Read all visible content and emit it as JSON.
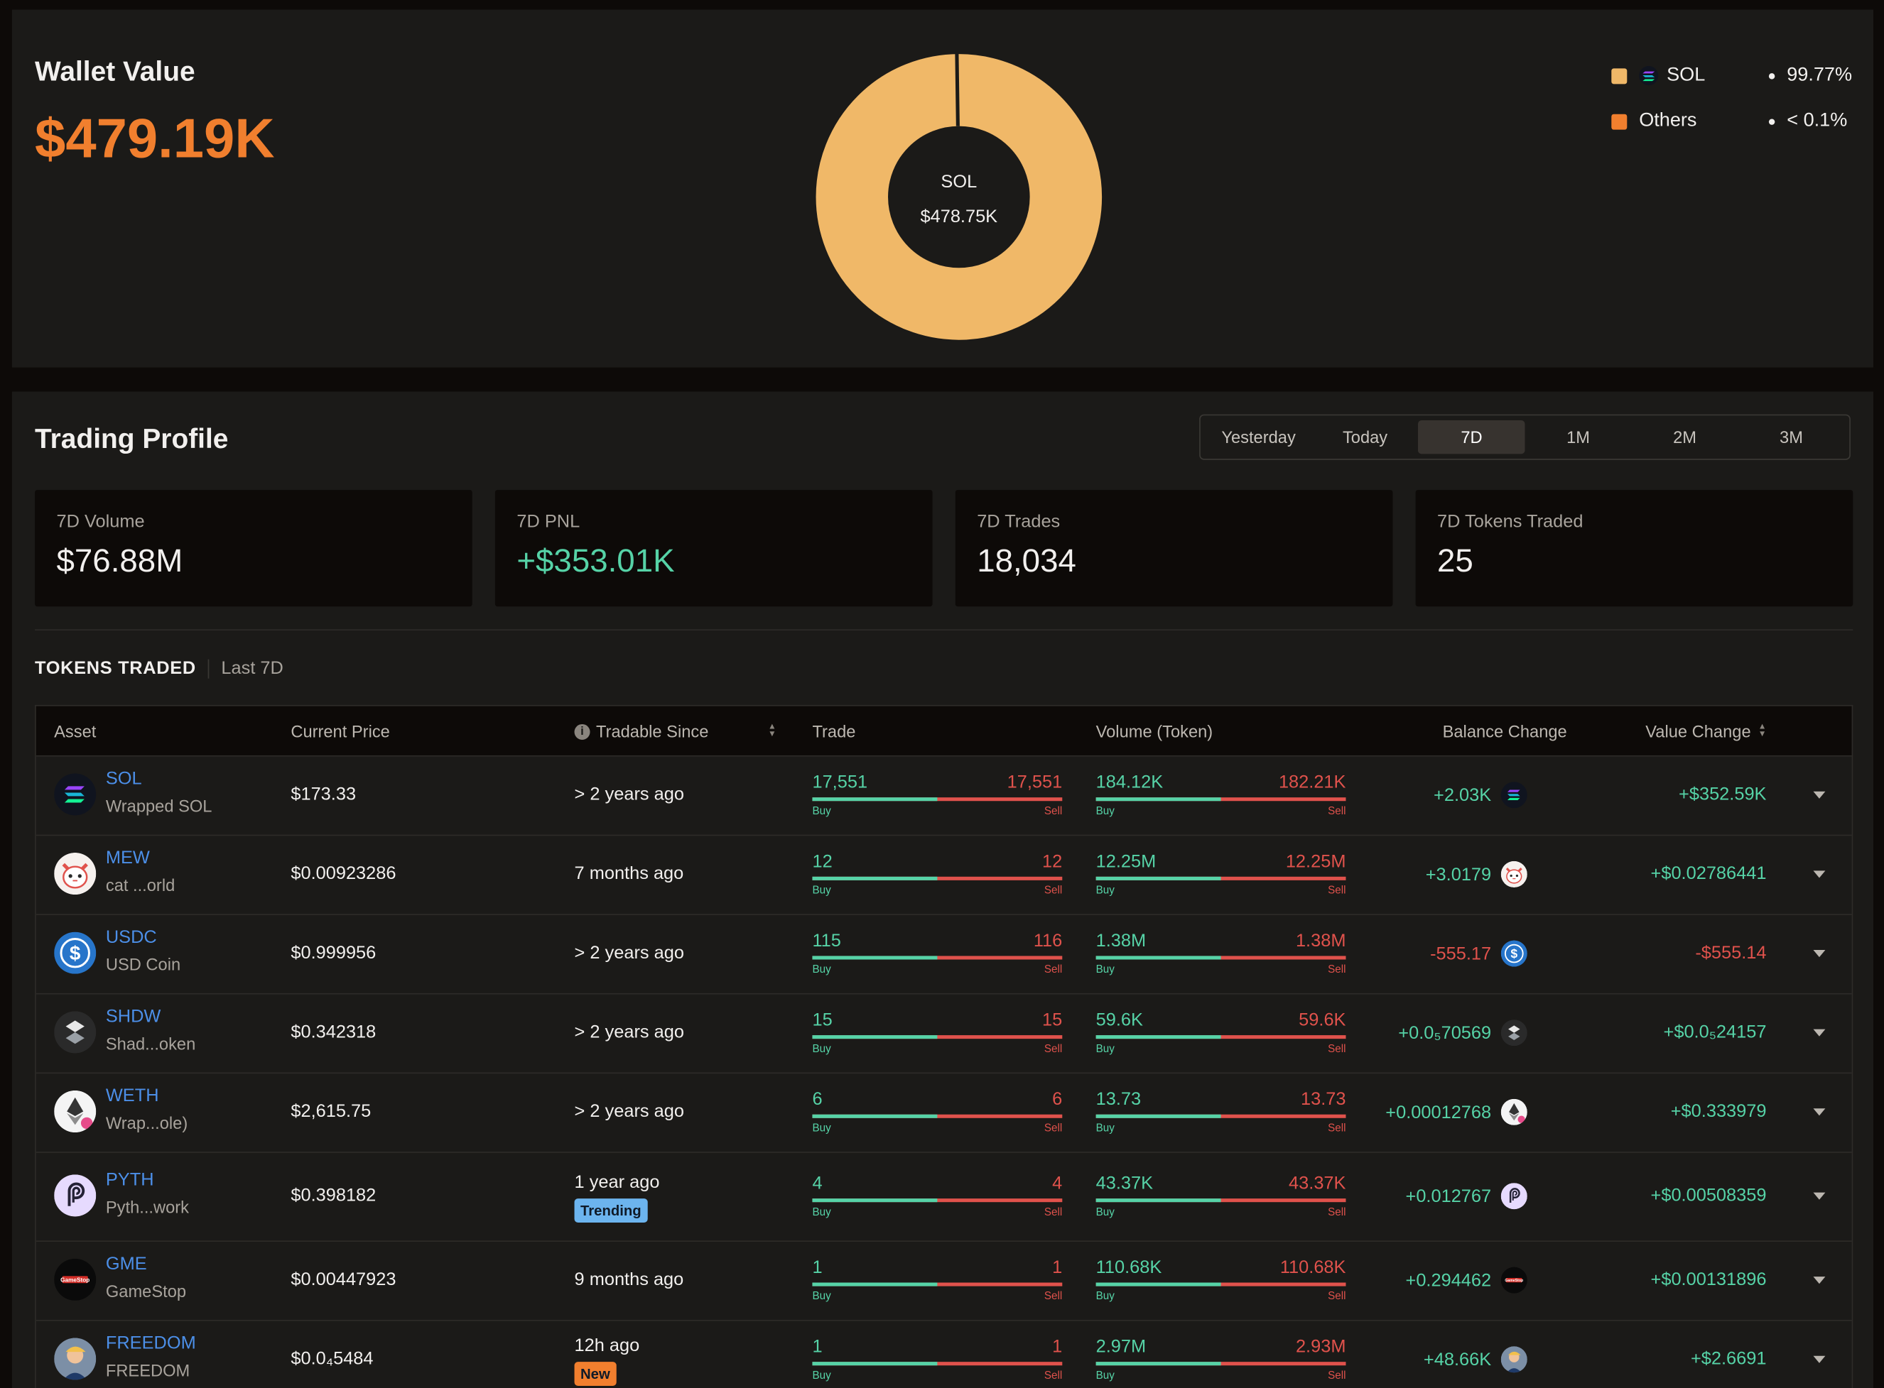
{
  "wallet": {
    "title": "Wallet Value",
    "value": "$479.19K",
    "donut_center_symbol": "SOL",
    "donut_center_value": "$478.75K",
    "donut_share_sol": 0.9977,
    "legend": [
      {
        "name": "SOL",
        "pct": "99.77%",
        "color": "#f0b868",
        "icon": "sol-icon"
      },
      {
        "name": "Others",
        "pct": "< 0.1%",
        "color": "#f17f2e",
        "icon": ""
      }
    ]
  },
  "trading_profile": {
    "title": "Trading Profile",
    "periods": [
      "Yesterday",
      "Today",
      "7D",
      "1M",
      "2M",
      "3M"
    ],
    "active_period": "7D",
    "stats": [
      {
        "label": "7D Volume",
        "value": "$76.88M",
        "color": "#f2f0ee"
      },
      {
        "label": "7D PNL",
        "value": "+$353.01K",
        "color": "#56d3a7"
      },
      {
        "label": "7D Trades",
        "value": "18,034",
        "color": "#f2f0ee"
      },
      {
        "label": "7D Tokens Traded",
        "value": "25",
        "color": "#f2f0ee"
      }
    ]
  },
  "tokens_traded": {
    "title": "TOKENS TRADED",
    "subtitle": "Last 7D",
    "columns": [
      "Asset",
      "Current Price",
      "Tradable Since",
      "Trade",
      "Volume (Token)",
      "Balance Change",
      "Value Change"
    ],
    "buy_label": "Buy",
    "sell_label": "Sell",
    "rows": [
      {
        "symbol": "SOL",
        "name": "Wrapped SOL",
        "price": "$173.33",
        "since": "> 2 years ago",
        "badge": "",
        "trade_buy": "17,551",
        "trade_sell": "17,551",
        "trade_buy_share": 0.5,
        "vol_buy": "184.12K",
        "vol_sell": "182.21K",
        "vol_buy_share": 0.5,
        "balance": "+2.03K",
        "balance_sign": "pos",
        "value": "+$352.59K",
        "value_sign": "pos",
        "icon": "sol-icon"
      },
      {
        "symbol": "MEW",
        "name": "cat ...orld",
        "price": "$0.00923286",
        "since": "7 months ago",
        "badge": "",
        "trade_buy": "12",
        "trade_sell": "12",
        "trade_buy_share": 0.5,
        "vol_buy": "12.25M",
        "vol_sell": "12.25M",
        "vol_buy_share": 0.5,
        "balance": "+3.0179",
        "balance_sign": "pos",
        "value": "+$0.02786441",
        "value_sign": "pos",
        "icon": "mew-cat-icon"
      },
      {
        "symbol": "USDC",
        "name": "USD Coin",
        "price": "$0.999956",
        "since": "> 2 years ago",
        "badge": "",
        "trade_buy": "115",
        "trade_sell": "116",
        "trade_buy_share": 0.5,
        "vol_buy": "1.38M",
        "vol_sell": "1.38M",
        "vol_buy_share": 0.5,
        "balance": "-555.17",
        "balance_sign": "neg",
        "value": "-$555.14",
        "value_sign": "neg",
        "icon": "usdc-icon"
      },
      {
        "symbol": "SHDW",
        "name": "Shad...oken",
        "price": "$0.342318",
        "since": "> 2 years ago",
        "badge": "",
        "trade_buy": "15",
        "trade_sell": "15",
        "trade_buy_share": 0.5,
        "vol_buy": "59.6K",
        "vol_sell": "59.6K",
        "vol_buy_share": 0.5,
        "balance": "+0.0₅70569",
        "balance_sign": "pos",
        "value": "+$0.0₅24157",
        "value_sign": "pos",
        "icon": "shdw-icon"
      },
      {
        "symbol": "WETH",
        "name": "Wrap...ole)",
        "price": "$2,615.75",
        "since": "> 2 years ago",
        "badge": "",
        "trade_buy": "6",
        "trade_sell": "6",
        "trade_buy_share": 0.5,
        "vol_buy": "13.73",
        "vol_sell": "13.73",
        "vol_buy_share": 0.5,
        "balance": "+0.00012768",
        "balance_sign": "pos",
        "value": "+$0.333979",
        "value_sign": "pos",
        "icon": "eth-icon"
      },
      {
        "symbol": "PYTH",
        "name": "Pyth...work",
        "price": "$0.398182",
        "since": "1 year ago",
        "badge": "Trending",
        "trade_buy": "4",
        "trade_sell": "4",
        "trade_buy_share": 0.5,
        "vol_buy": "43.37K",
        "vol_sell": "43.37K",
        "vol_buy_share": 0.5,
        "balance": "+0.012767",
        "balance_sign": "pos",
        "value": "+$0.00508359",
        "value_sign": "pos",
        "icon": "pyth-icon"
      },
      {
        "symbol": "GME",
        "name": "GameStop",
        "price": "$0.00447923",
        "since": "9 months ago",
        "badge": "",
        "trade_buy": "1",
        "trade_sell": "1",
        "trade_buy_share": 0.5,
        "vol_buy": "110.68K",
        "vol_sell": "110.68K",
        "vol_buy_share": 0.5,
        "balance": "+0.294462",
        "balance_sign": "pos",
        "value": "+$0.00131896",
        "value_sign": "pos",
        "icon": "gamestop-icon"
      },
      {
        "symbol": "FREEDOM",
        "name": "FREEDOM",
        "price": "$0.0₄5484",
        "since": "12h ago",
        "badge": "New",
        "trade_buy": "1",
        "trade_sell": "1",
        "trade_buy_share": 0.5,
        "vol_buy": "2.97M",
        "vol_sell": "2.93M",
        "vol_buy_share": 0.5,
        "balance": "+48.66K",
        "balance_sign": "pos",
        "value": "+$2.6691",
        "value_sign": "pos",
        "icon": "freedom-icon"
      }
    ]
  }
}
